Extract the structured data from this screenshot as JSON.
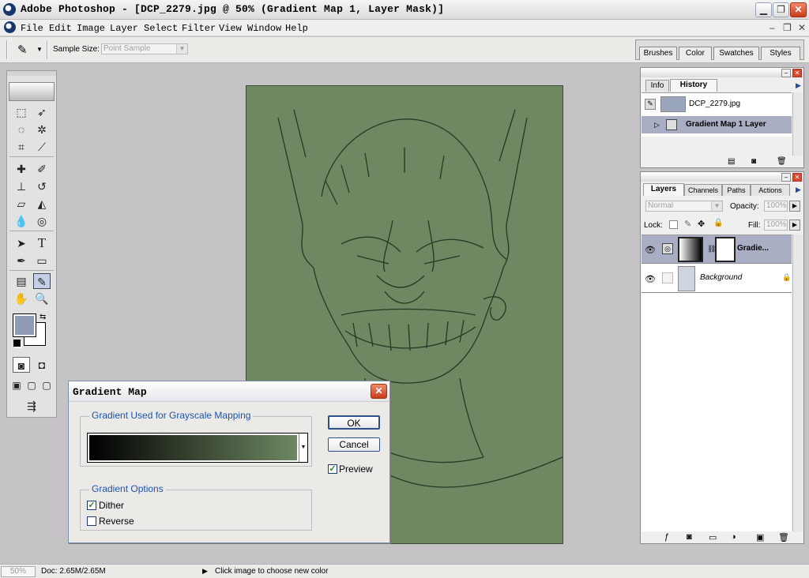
{
  "window": {
    "title": "Adobe Photoshop - [DCP_2279.jpg @ 50% (Gradient Map 1, Layer Mask)]"
  },
  "menu": [
    "File",
    "Edit",
    "Image",
    "Layer",
    "Select",
    "Filter",
    "View",
    "Window",
    "Help"
  ],
  "options": {
    "sample_size_label": "Sample Size:",
    "sample_size_value": "Point Sample"
  },
  "palette_well": [
    "Brushes",
    "Color",
    "Swatches",
    "Styles"
  ],
  "history_panel": {
    "tabs": [
      "Info",
      "History"
    ],
    "snapshot": "DCP_2279.jpg",
    "states": [
      "Gradient Map 1 Layer"
    ]
  },
  "layers_panel": {
    "tabs": [
      "Layers",
      "Channels",
      "Paths",
      "Actions"
    ],
    "blend_mode": "Normal",
    "opacity_label": "Opacity:",
    "opacity_value": "100%",
    "lock_label": "Lock:",
    "fill_label": "Fill:",
    "fill_value": "100%",
    "layers": [
      {
        "name": "Gradie...",
        "selected": true
      },
      {
        "name": "Background",
        "selected": false
      }
    ]
  },
  "dialog": {
    "title": "Gradient Map",
    "group_mapping": "Gradient Used for Grayscale Mapping",
    "group_options": "Gradient Options",
    "dither_label": "Dither",
    "dither_checked": true,
    "reverse_label": "Reverse",
    "reverse_checked": false,
    "ok_label": "OK",
    "cancel_label": "Cancel",
    "preview_label": "Preview",
    "preview_checked": true,
    "gradient_start": "#000000",
    "gradient_end": "#6e8862"
  },
  "status": {
    "zoom": "50%",
    "doc": "Doc: 2.65M/2.65M",
    "hint": "Click image to choose new color"
  },
  "colors": {
    "foreground": "#8f9bb5",
    "background": "#ffffff",
    "canvas_tint": "#6e8862"
  }
}
